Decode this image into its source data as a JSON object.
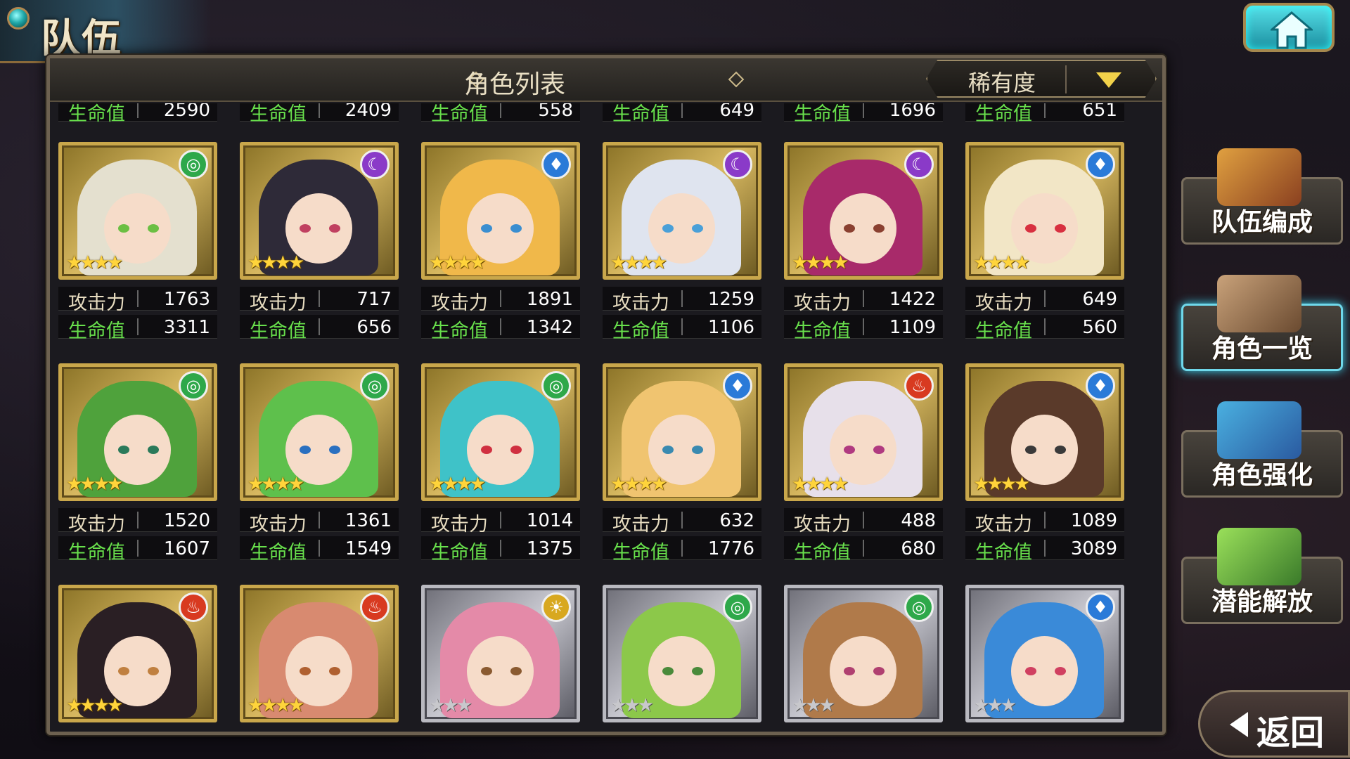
{
  "title": "队伍",
  "panel": {
    "title": "角色列表",
    "sort_label": "稀有度"
  },
  "labels": {
    "atk": "攻击力",
    "hp": "生命值"
  },
  "top_partial_values": [
    "2590",
    "2409",
    "558",
    "649",
    "1696",
    "651"
  ],
  "cards": [
    {
      "atk": "1763",
      "hp": "3311",
      "element": "wind",
      "stars": "★★★★",
      "frame": "gold",
      "hair": "#e4e0cf",
      "eye": "#6bbf43"
    },
    {
      "atk": "717",
      "hp": "656",
      "element": "dark",
      "stars": "★★★★",
      "frame": "gold",
      "hair": "#2e2a38",
      "eye": "#c04060"
    },
    {
      "atk": "1891",
      "hp": "1342",
      "element": "water",
      "stars": "★★★★",
      "frame": "gold",
      "hair": "#f0b84a",
      "eye": "#3a8ed0"
    },
    {
      "atk": "1259",
      "hp": "1106",
      "element": "dark",
      "stars": "★★★★",
      "frame": "gold",
      "hair": "#dfe4ef",
      "eye": "#4aa0d8"
    },
    {
      "atk": "1422",
      "hp": "1109",
      "element": "dark",
      "stars": "★★★★",
      "frame": "gold",
      "hair": "#a82a6a",
      "eye": "#8a4030"
    },
    {
      "atk": "649",
      "hp": "560",
      "element": "water",
      "stars": "★★★★",
      "frame": "gold",
      "hair": "#f2e6c6",
      "eye": "#d83040"
    },
    {
      "atk": "1520",
      "hp": "1607",
      "element": "wind",
      "stars": "★★★★",
      "frame": "gold",
      "hair": "#4fa23c",
      "eye": "#2a7a5a"
    },
    {
      "atk": "1361",
      "hp": "1549",
      "element": "wind",
      "stars": "★★★★",
      "frame": "gold",
      "hair": "#5ec04c",
      "eye": "#2a70c0"
    },
    {
      "atk": "1014",
      "hp": "1375",
      "element": "wind",
      "stars": "★★★★",
      "frame": "gold",
      "hair": "#3fc2c8",
      "eye": "#d03040"
    },
    {
      "atk": "632",
      "hp": "1776",
      "element": "water",
      "stars": "★★★★",
      "frame": "gold",
      "hair": "#f0c470",
      "eye": "#3a8ab0"
    },
    {
      "atk": "488",
      "hp": "680",
      "element": "fire",
      "stars": "★★★★",
      "frame": "gold",
      "hair": "#e7e0ea",
      "eye": "#b03a80"
    },
    {
      "atk": "1089",
      "hp": "3089",
      "element": "water",
      "stars": "★★★★",
      "frame": "gold",
      "hair": "#5a3a2a",
      "eye": "#3a3a3a"
    },
    {
      "element": "fire",
      "stars": "★★★★",
      "frame": "gold",
      "hair": "#2a1f24",
      "eye": "#c08040"
    },
    {
      "element": "fire",
      "stars": "★★★★",
      "frame": "gold",
      "hair": "#d88a70",
      "eye": "#b06030"
    },
    {
      "element": "light",
      "stars": "★★★",
      "frame": "silver",
      "hair": "#e48aa8",
      "eye": "#8a5a30"
    },
    {
      "element": "wind",
      "stars": "★★★",
      "frame": "silver",
      "hair": "#8cc84a",
      "eye": "#4a8a3a"
    },
    {
      "element": "wind",
      "stars": "★★★",
      "frame": "silver",
      "hair": "#b07a4a",
      "eye": "#b04070"
    },
    {
      "element": "water",
      "stars": "★★★",
      "frame": "silver",
      "hair": "#3a8ad8",
      "eye": "#d04060"
    }
  ],
  "element_icons": {
    "wind": {
      "glyph": "◎",
      "color": "#2ea84a"
    },
    "dark": {
      "glyph": "☾",
      "color": "#8a3ac8"
    },
    "water": {
      "glyph": "♦",
      "color": "#2a7ad8"
    },
    "fire": {
      "glyph": "♨",
      "color": "#d83a20"
    },
    "light": {
      "glyph": "☀",
      "color": "#d8a820"
    }
  },
  "menu": [
    {
      "label": "队伍编成",
      "icon": "team-formation-icon",
      "active": false
    },
    {
      "label": "角色一览",
      "icon": "character-book-icon",
      "active": true
    },
    {
      "label": "角色强化",
      "icon": "enhance-crystal-icon",
      "active": false
    },
    {
      "label": "潜能解放",
      "icon": "potential-orb-icon",
      "active": false
    }
  ],
  "back_label": "返回"
}
